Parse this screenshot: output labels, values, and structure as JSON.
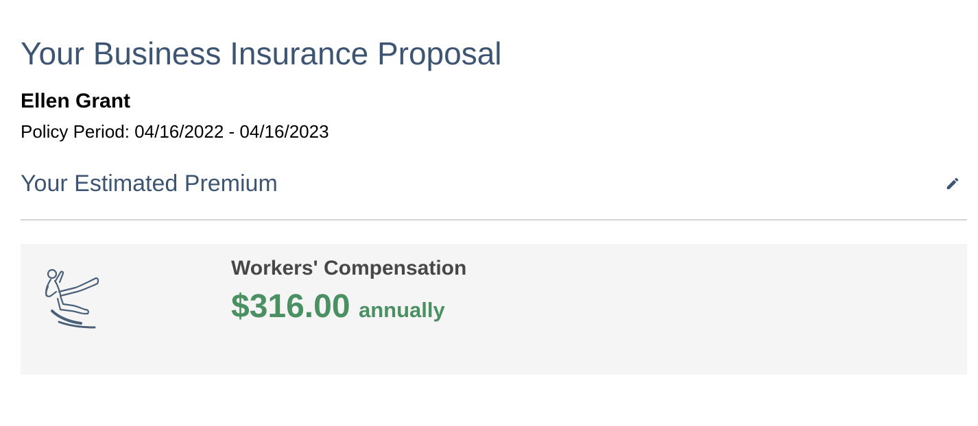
{
  "header": {
    "title": "Your Business Insurance Proposal",
    "customer_name": "Ellen Grant",
    "policy_period": "Policy Period: 04/16/2022 - 04/16/2023"
  },
  "premium_section": {
    "title": "Your Estimated Premium",
    "edit_icon": "pencil-icon"
  },
  "coverages": [
    {
      "name": "Workers' Compensation",
      "amount": "$316.00",
      "frequency": "annually",
      "icon": "slip-fall-icon"
    }
  ],
  "colors": {
    "heading": "#3d5573",
    "price": "#4a9063",
    "card_background": "#f5f5f5",
    "divider": "#d3d3d3",
    "coverage_name": "#474747"
  }
}
